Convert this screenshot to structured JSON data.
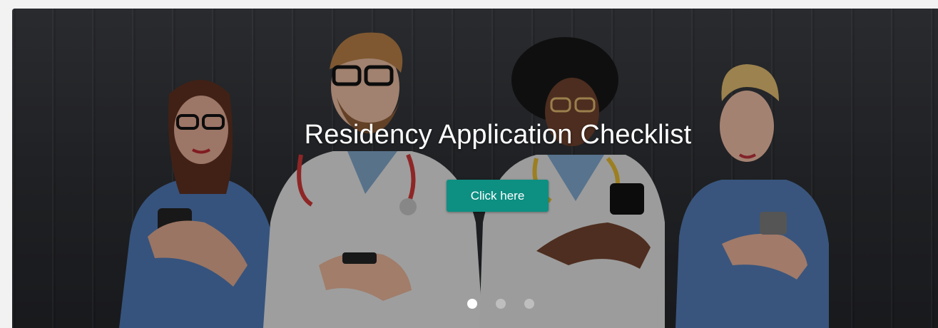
{
  "hero": {
    "title": "Residency Application Checklist",
    "cta_label": "Click here",
    "image_alt": "",
    "colors": {
      "accent": "#0d8f82",
      "overlay": "rgba(0,0,0,0.28)",
      "background": "#2a2c30"
    }
  },
  "carousel": {
    "slide_count": 3,
    "active_index": 0
  }
}
